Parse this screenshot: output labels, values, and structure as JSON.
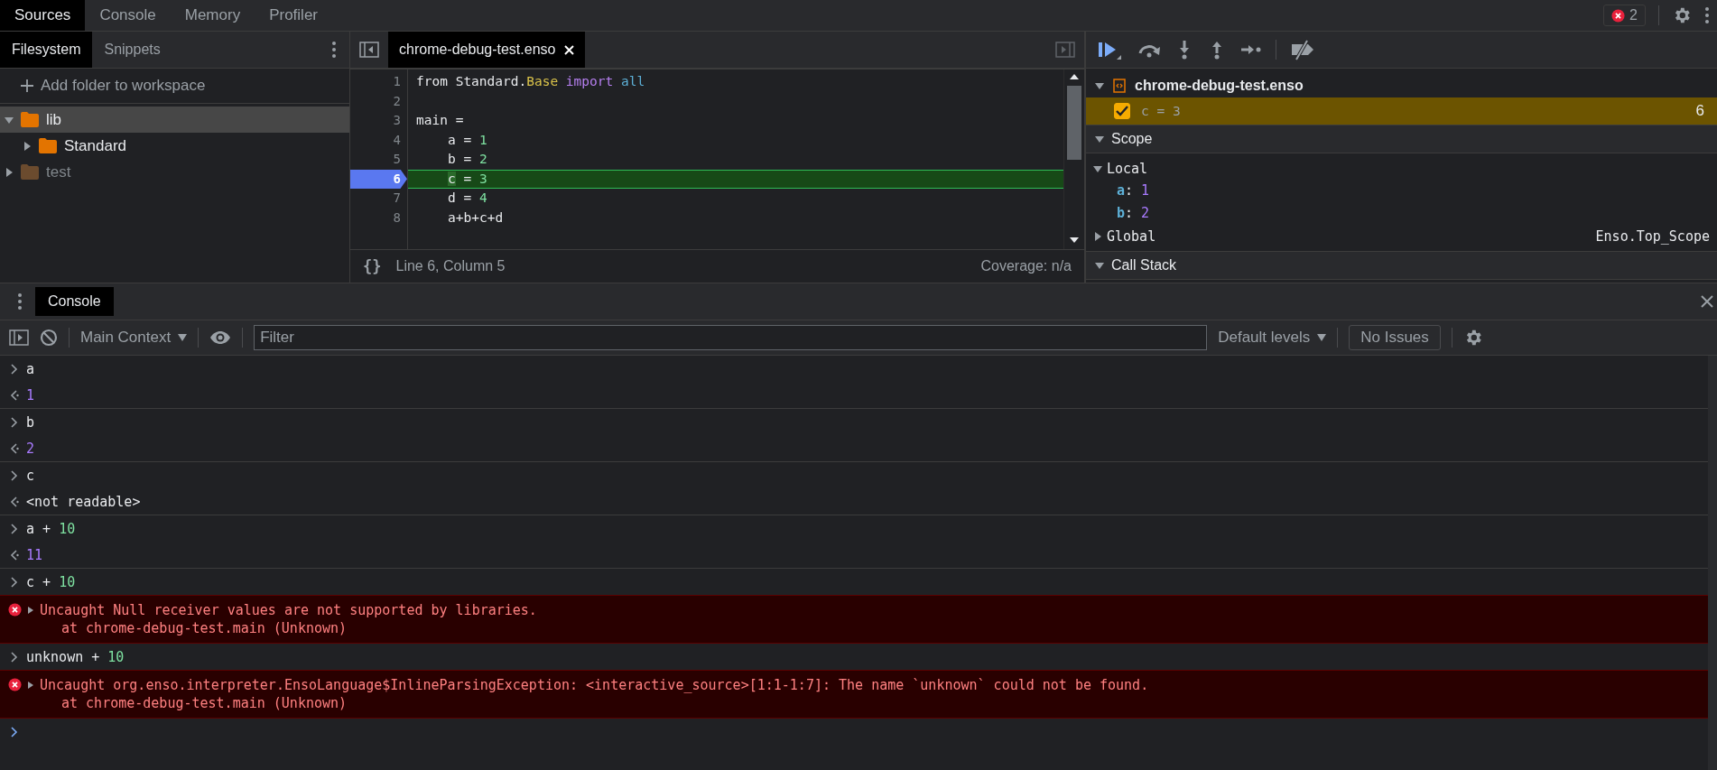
{
  "top_tabs": [
    {
      "label": "Sources",
      "selected": true
    },
    {
      "label": "Console",
      "selected": false
    },
    {
      "label": "Memory",
      "selected": false
    },
    {
      "label": "Profiler",
      "selected": false
    }
  ],
  "error_badge": {
    "count": "2"
  },
  "navigator": {
    "tabs": [
      {
        "label": "Filesystem",
        "selected": true
      },
      {
        "label": "Snippets",
        "selected": false
      }
    ],
    "add_folder": "Add folder to workspace",
    "tree": [
      {
        "name": "lib",
        "expanded": true,
        "selected": true,
        "dimmed": false,
        "children": [
          {
            "name": "Standard",
            "expanded": false,
            "selected": false,
            "dimmed": false
          }
        ]
      },
      {
        "name": "test",
        "expanded": false,
        "selected": false,
        "dimmed": true
      }
    ]
  },
  "editor": {
    "tab": "chrome-debug-test.enso",
    "lines": [
      {
        "number": "1",
        "paused": false,
        "tokens": [
          {
            "text": "from Standard.",
            "kind": "plain"
          },
          {
            "text": "Base",
            "kind": "type"
          },
          {
            "text": " import",
            "kind": "keyword"
          },
          {
            "text": " all",
            "kind": "builtin"
          }
        ]
      },
      {
        "number": "2",
        "paused": false
      },
      {
        "number": "3",
        "paused": false,
        "tokens": [
          {
            "text": "main =",
            "kind": "plain"
          }
        ],
        "children": [
          {
            "number": "4",
            "paused": false,
            "tokens": [
              {
                "text": "a = ",
                "kind": "plain"
              },
              {
                "text": "1",
                "kind": "number"
              }
            ]
          },
          {
            "number": "5",
            "paused": false,
            "tokens": [
              {
                "text": "b = ",
                "kind": "plain"
              },
              {
                "text": "2",
                "kind": "number"
              }
            ]
          },
          {
            "number": "6",
            "paused": true,
            "tokens": [
              {
                "text": "c",
                "kind": "mark"
              },
              {
                "text": " = ",
                "kind": "plain"
              },
              {
                "text": "3",
                "kind": "number"
              }
            ]
          },
          {
            "number": "7",
            "paused": false,
            "tokens": [
              {
                "text": "d = ",
                "kind": "plain"
              },
              {
                "text": "4",
                "kind": "number"
              }
            ]
          },
          {
            "number": "8",
            "paused": false,
            "tokens": [
              {
                "text": "a+b+c+d",
                "kind": "plain"
              }
            ]
          }
        ]
      }
    ],
    "format_button": "{}",
    "position": "Line 6, Column 5",
    "coverage": "Coverage: n/a"
  },
  "debugger": {
    "breakpoints": {
      "file": "chrome-debug-test.enso",
      "expanded": true,
      "items": [
        {
          "code": "c = 3",
          "line": "6",
          "checked": true,
          "hit": true
        }
      ]
    },
    "scope": {
      "title": "Scope",
      "expanded": true,
      "groups": [
        {
          "name": "Local",
          "expanded": true,
          "vars": [
            {
              "name": "a",
              "separator": ":",
              "value": "1"
            },
            {
              "name": "b",
              "separator": ":",
              "value": "2"
            }
          ]
        },
        {
          "name": "Global",
          "expanded": false,
          "value": "Enso.Top_Scope"
        }
      ]
    },
    "call_stack": {
      "title": "Call Stack",
      "expanded": true
    }
  },
  "console": {
    "drawer_tabs": [
      {
        "label": "Console",
        "selected": true
      }
    ],
    "context": "Main Context",
    "filter_placeholder": "Filter",
    "levels": "Default levels",
    "issues": "No Issues",
    "messages": [
      {
        "kind": "input",
        "tokens": [
          {
            "text": "a",
            "kind": "plain"
          }
        ]
      },
      {
        "kind": "result",
        "tokens": [
          {
            "text": "1",
            "kind": "value"
          }
        ]
      },
      {
        "kind": "input",
        "tokens": [
          {
            "text": "b",
            "kind": "plain"
          }
        ]
      },
      {
        "kind": "result",
        "tokens": [
          {
            "text": "2",
            "kind": "value"
          }
        ]
      },
      {
        "kind": "input",
        "tokens": [
          {
            "text": "c",
            "kind": "plain"
          }
        ]
      },
      {
        "kind": "result",
        "tokens": [
          {
            "text": "<not readable>",
            "kind": "plain"
          }
        ]
      },
      {
        "kind": "input",
        "tokens": [
          {
            "text": "a + ",
            "kind": "plain"
          },
          {
            "text": "10",
            "kind": "number"
          }
        ]
      },
      {
        "kind": "result",
        "tokens": [
          {
            "text": "11",
            "kind": "value"
          }
        ]
      },
      {
        "kind": "input",
        "tokens": [
          {
            "text": "c + ",
            "kind": "plain"
          },
          {
            "text": "10",
            "kind": "number"
          }
        ]
      },
      {
        "kind": "error",
        "expanded": false,
        "message": "Uncaught Null receiver values are not supported by libraries.",
        "trace": "at chrome-debug-test.main (Unknown)"
      },
      {
        "kind": "input",
        "tokens": [
          {
            "text": "unknown + ",
            "kind": "plain"
          },
          {
            "text": "10",
            "kind": "number"
          }
        ]
      },
      {
        "kind": "error",
        "expanded": false,
        "message": "Uncaught org.enso.interpreter.EnsoLanguage$InlineParsingException: <interactive_source>[1:1-1:7]: The name `unknown` could not be found.",
        "trace": "at chrome-debug-test.main (Unknown)"
      }
    ]
  }
}
